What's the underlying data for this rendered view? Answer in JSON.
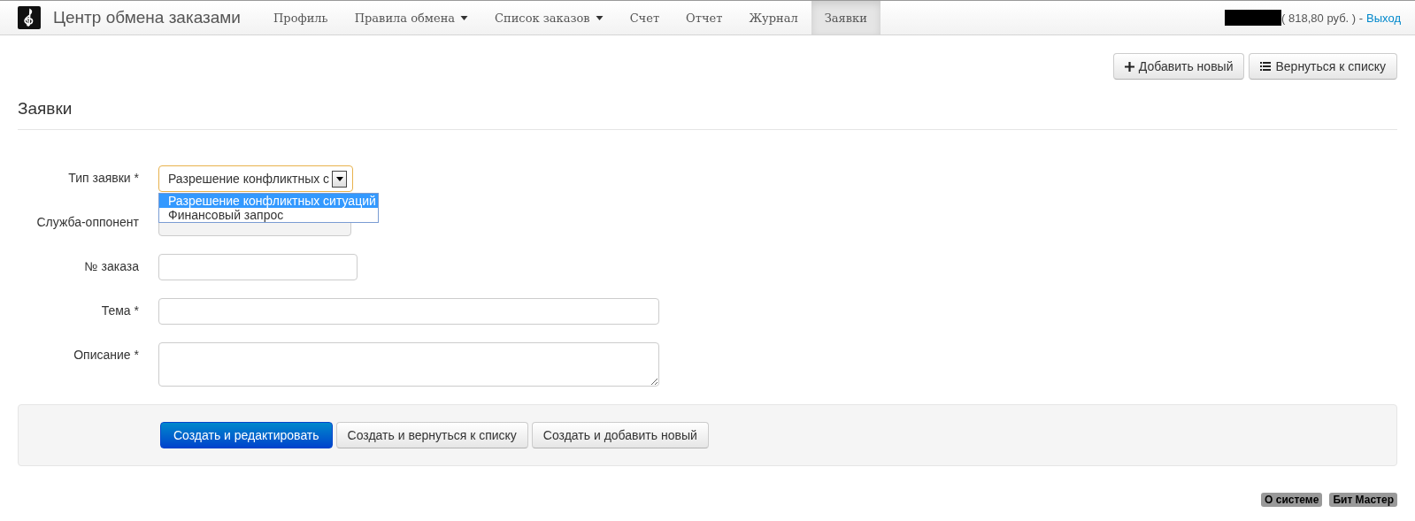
{
  "navbar": {
    "brand": "Центр обмена заказами",
    "items": [
      {
        "label": "Профиль",
        "dropdown": false,
        "selected": false
      },
      {
        "label": "Правила обмена",
        "dropdown": true,
        "selected": false
      },
      {
        "label": "Список заказов",
        "dropdown": true,
        "selected": false
      },
      {
        "label": "Счет",
        "dropdown": false,
        "selected": false
      },
      {
        "label": "Отчет",
        "dropdown": false,
        "selected": false
      },
      {
        "label": "Журнал",
        "dropdown": false,
        "selected": false
      },
      {
        "label": "Заявки",
        "dropdown": false,
        "selected": true
      }
    ],
    "balance": "( 818,80 руб. ) -",
    "logout": "Выход"
  },
  "toolbar": [
    {
      "label": "Добавить новый"
    },
    {
      "label": "Вернуться к списку"
    }
  ],
  "heading": "Заявки",
  "form": {
    "fields": [
      {
        "label": "Тип заявки *",
        "kind": "select",
        "value": "Разрешение конфликтных с",
        "open": true,
        "options": [
          {
            "label": "Разрешение конфликтных ситуаций",
            "selected": true
          },
          {
            "label": "Финансовый запрос",
            "selected": false
          }
        ]
      },
      {
        "label": "Служба-оппонент",
        "kind": "select-disabled"
      },
      {
        "label": "№ заказа",
        "kind": "input-short"
      },
      {
        "label": "Тема *",
        "kind": "input-long"
      },
      {
        "label": "Описание *",
        "kind": "textarea"
      }
    ],
    "actions": [
      {
        "label": "Создать и редактировать",
        "primary": true
      },
      {
        "label": "Создать и вернуться к списку",
        "primary": false
      },
      {
        "label": "Создать и добавить новый",
        "primary": false
      }
    ]
  },
  "footer": [
    "О системе",
    "Бит Мастер"
  ]
}
